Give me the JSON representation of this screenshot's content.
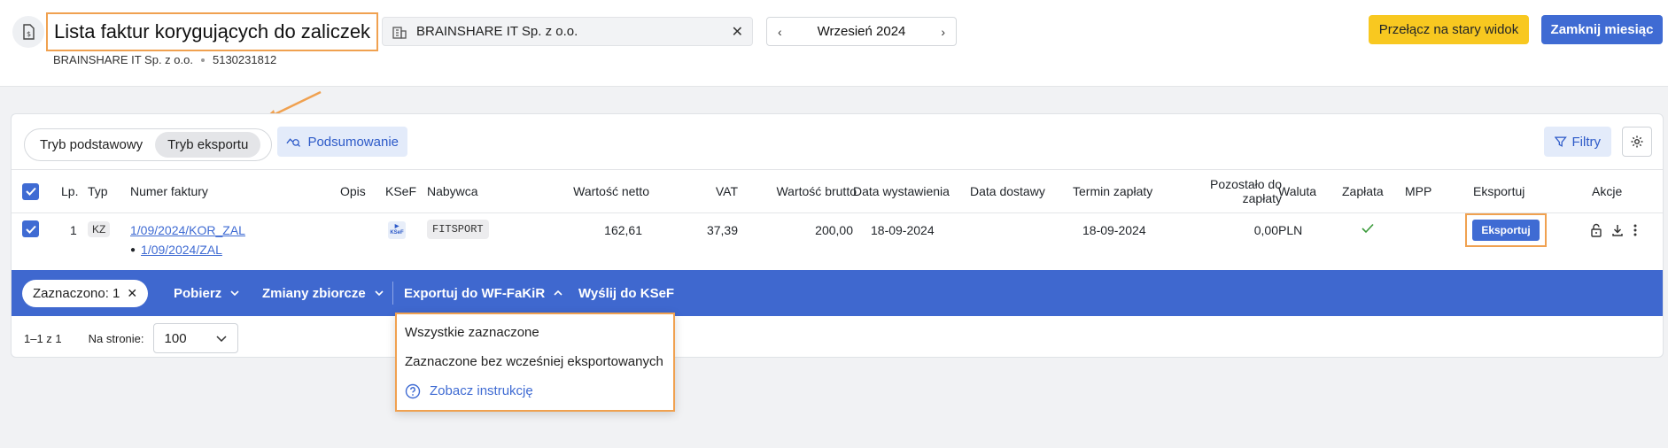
{
  "header": {
    "title": "Lista faktur korygujących do zaliczek",
    "company_name": "BRAINSHARE IT Sp. z o.o.",
    "company_nip": "5130231812",
    "company_select_value": "BRAINSHARE IT Sp. z o.o.",
    "month": "Wrzesień 2024",
    "btn_old_view": "Przełącz na stary widok",
    "btn_close_month": "Zamknij miesiąc"
  },
  "toolbar": {
    "mode_basic": "Tryb podstawowy",
    "mode_export": "Tryb eksportu",
    "summary": "Podsumowanie",
    "filters": "Filtry"
  },
  "table": {
    "columns": {
      "lp": "Lp.",
      "typ": "Typ",
      "numer": "Numer faktury",
      "opis": "Opis",
      "ksef": "KSeF",
      "nabywca": "Nabywca",
      "netto": "Wartość netto",
      "vat": "VAT",
      "brutto": "Wartość brutto",
      "data_wyst": "Data wystawienia",
      "data_dost": "Data dostawy",
      "termin": "Termin zapłaty",
      "pozostalo": "Pozostało do zapłaty",
      "waluta": "Waluta",
      "zaplata": "Zapłata",
      "mpp": "MPP",
      "eksportuj": "Eksportuj",
      "akcje": "Akcje"
    },
    "rows": [
      {
        "lp": "1",
        "typ": "KZ",
        "numer": "1/09/2024/KOR_ZAL",
        "numer_sub": "1/09/2024/ZAL",
        "ksef_label": "KSeF",
        "nabywca": "FITSPORT",
        "netto": "162,61",
        "vat": "37,39",
        "brutto": "200,00",
        "data_wyst": "18-09-2024",
        "termin": "18-09-2024",
        "pozostalo": "0,00",
        "waluta": "PLN",
        "export_btn": "Eksportuj"
      }
    ]
  },
  "bulk_bar": {
    "selected": "Zaznaczono: 1",
    "download": "Pobierz",
    "bulk_changes": "Zmiany zbiorcze",
    "export_wf": "Exportuj do WF-FaKiR",
    "send_ksef": "Wyślij do KSeF"
  },
  "pager": {
    "range": "1–1 z 1",
    "per_page_label": "Na stronie:",
    "per_page_value": "100"
  },
  "dropdown": {
    "item_all": "Wszystkie zaznaczone",
    "item_not_exported": "Zaznaczone bez wcześniej eksportowanych",
    "item_instructions": "Zobacz instrukcję"
  },
  "colors": {
    "primary": "#3f6bd3",
    "accent_yellow": "#f8c820",
    "highlight_orange": "#f0a150"
  }
}
